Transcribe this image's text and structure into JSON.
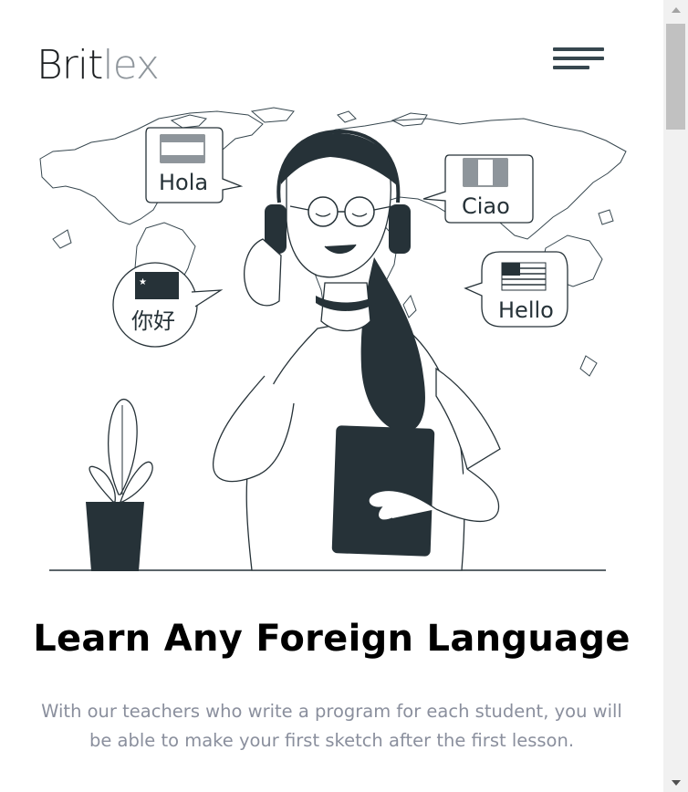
{
  "header": {
    "logo_main": "Brit",
    "logo_accent": "lex",
    "menu_icon": "hamburger-menu-icon"
  },
  "hero": {
    "bubbles": {
      "spanish": "Hola",
      "italian": "Ciao",
      "chinese": "你好",
      "english": "Hello"
    }
  },
  "content": {
    "headline": "Learn Any Foreign Language",
    "subtext": "With our teachers who write a program for each student, you will be able to make your first sketch after the first lesson."
  },
  "colors": {
    "ink": "#263238",
    "logo_accent": "#8e959b",
    "subtext": "#8a8f9d"
  }
}
